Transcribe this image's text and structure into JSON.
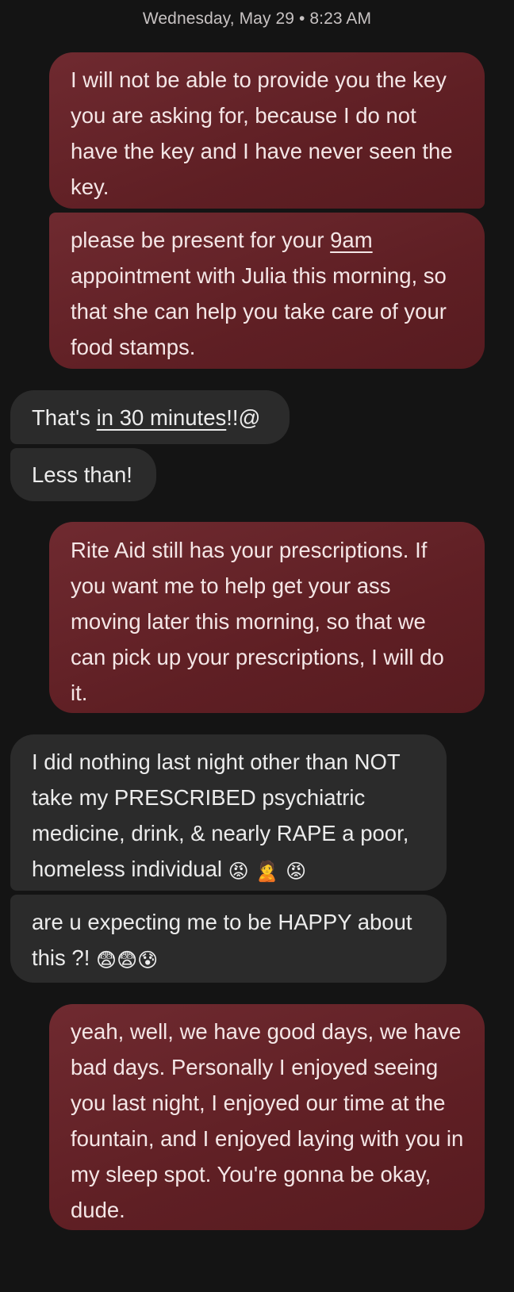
{
  "timestamp": "Wednesday, May 29 • 8:23 AM",
  "messages": [
    {
      "direction": "outgoing",
      "parts": [
        {
          "text": "I will not be able to provide you the key you are asking for, because I do not have the key and I have never seen the key."
        }
      ]
    },
    {
      "direction": "outgoing",
      "parts": [
        {
          "text": "please be present for your "
        },
        {
          "text": "9am",
          "link": true
        },
        {
          "text": " appointment with Julia this morning, so that she can help you take care of your food stamps."
        }
      ]
    },
    {
      "direction": "incoming",
      "parts": [
        {
          "text": "That's "
        },
        {
          "text": "in 30 minutes",
          "link": true
        },
        {
          "text": "!!@"
        }
      ]
    },
    {
      "direction": "incoming",
      "parts": [
        {
          "text": "Less than!"
        }
      ]
    },
    {
      "direction": "outgoing",
      "parts": [
        {
          "text": "Rite Aid still has your prescriptions. If you want me to help get your ass moving later this morning, so that we can pick up your prescriptions, I will do it."
        }
      ]
    },
    {
      "direction": "incoming",
      "parts": [
        {
          "text": "I did nothing last night other than NOT take my PRESCRIBED psychiatric medicine, drink, & nearly RAPE a poor, homeless individual "
        },
        {
          "text": "😡",
          "emoji": "angry-face-emoji"
        },
        {
          "text": " "
        },
        {
          "text": "🙎",
          "emoji": "person-pouting-emoji"
        },
        {
          "text": " "
        },
        {
          "text": "😡",
          "emoji": "angry-face-emoji"
        }
      ]
    },
    {
      "direction": "incoming",
      "parts": [
        {
          "text": "are u expecting me to be HAPPY about this ?! "
        },
        {
          "text": "😨",
          "emoji": "fearful-face-emoji"
        },
        {
          "text": "😨",
          "emoji": "fearful-face-emoji"
        },
        {
          "text": "😰",
          "emoji": "anxious-face-emoji"
        }
      ]
    },
    {
      "direction": "outgoing",
      "parts": [
        {
          "text": "yeah, well, we have good days, we have bad days. Personally I enjoyed seeing you last night, I enjoyed our time at the fountain, and I enjoyed laying with you in my sleep spot. You're gonna be okay, dude."
        }
      ]
    }
  ],
  "colors": {
    "background": "#141414",
    "outgoing_bubble": "#631f25",
    "incoming_bubble": "#2b2b2b",
    "text": "#f1e9e9",
    "timestamp_text": "#c7c2c2"
  }
}
